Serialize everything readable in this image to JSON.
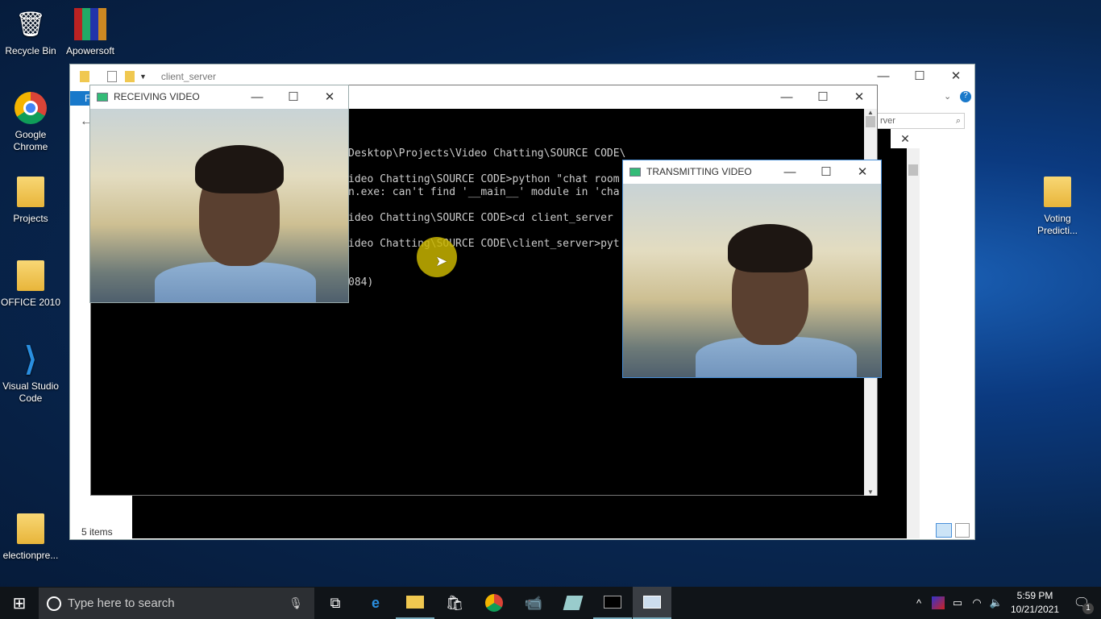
{
  "desktop": {
    "icons": [
      "Recycle Bin",
      "Apowersoft",
      "Google Chrome",
      "Projects",
      "OFFICE 2010",
      "Visual Studio Code",
      "electionpre...",
      "Voting Predicti..."
    ]
  },
  "explorer": {
    "title": "client_server",
    "ribbon_tab": "F",
    "search_placeholder": "rver",
    "status": "5 items"
  },
  "cmd": {
    "lines": [
      "Desktop\\Projects\\Video Chatting\\SOURCE CODE\\",
      "",
      "ideo Chatting\\SOURCE CODE>python \"chat room",
      "n.exe: can't find '__main__' module in 'cha",
      "",
      "ideo Chatting\\SOURCE CODE>cd client_server",
      "",
      "ideo Chatting\\SOURCE CODE\\client_server>pyt",
      "",
      "",
      "084)"
    ]
  },
  "receiving": {
    "title": "RECEIVING VIDEO"
  },
  "transmitting": {
    "title": "TRANSMITTING VIDEO"
  },
  "taskbar": {
    "search_placeholder": "Type here to search",
    "time": "5:59 PM",
    "date": "10/21/2021",
    "notification_count": "1"
  },
  "colors": {
    "accent": "#0078d7",
    "cursor_highlight": "#c8b400"
  }
}
